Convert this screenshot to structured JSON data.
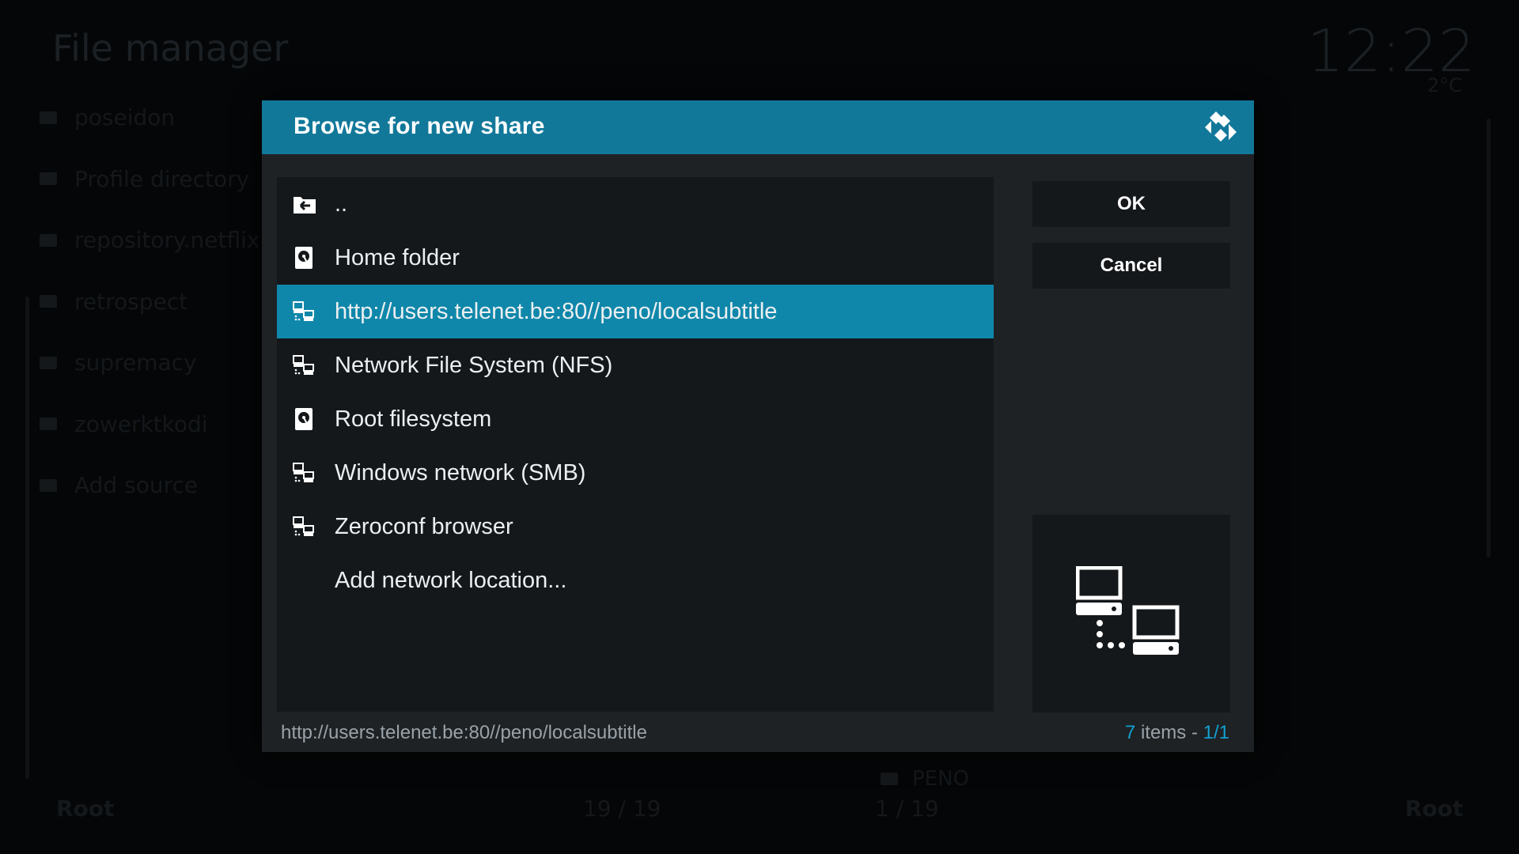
{
  "background": {
    "title": "File manager",
    "clock": "12:22",
    "weather": "2°C",
    "sources": [
      "poseidon",
      "Profile directory",
      "repository.netflix",
      "retrospect",
      "supremacy",
      "zowerktkodi",
      "Add source"
    ],
    "footer": {
      "left_label": "Root",
      "left_count": "19 / 19",
      "right_count": "1 / 19",
      "right_label": "Root",
      "right_item": "PENO"
    }
  },
  "dialog": {
    "title": "Browse for new share",
    "items": [
      {
        "label": "..",
        "icon": "folder-back-icon"
      },
      {
        "label": "Home folder",
        "icon": "harddisk-icon"
      },
      {
        "label": "http://users.telenet.be:80//peno/localsubtitle",
        "icon": "network-icon",
        "selected": true
      },
      {
        "label": "Network File System (NFS)",
        "icon": "network-icon"
      },
      {
        "label": "Root filesystem",
        "icon": "harddisk-icon"
      },
      {
        "label": "Windows network (SMB)",
        "icon": "network-icon"
      },
      {
        "label": "Zeroconf browser",
        "icon": "network-icon"
      },
      {
        "label": "Add network location...",
        "icon": ""
      }
    ],
    "buttons": {
      "ok": "OK",
      "cancel": "Cancel"
    },
    "preview_icon": "network-computers-icon",
    "footer": {
      "path": "http://users.telenet.be:80//peno/localsubtitle",
      "count_num": "7",
      "count_text": " items - ",
      "page": "1/1"
    }
  },
  "colors": {
    "accent": "#12789a",
    "selected": "#0f87aa",
    "panel": "#1e2225",
    "list": "#15181b"
  }
}
